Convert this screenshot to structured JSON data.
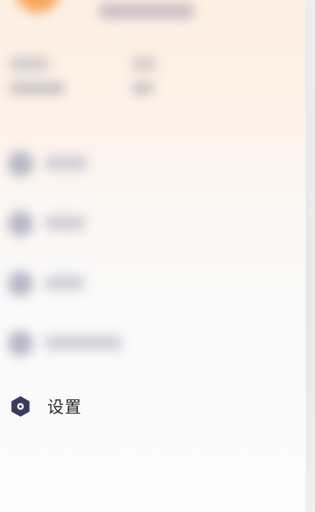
{
  "colors": {
    "avatar": "#f7a55e",
    "icon": "#3b3a5c",
    "header_bg": "#fdf0e3"
  },
  "drawer": {
    "menu": [
      {
        "label": "设置",
        "icon": "settings-hexagon-icon"
      }
    ]
  }
}
